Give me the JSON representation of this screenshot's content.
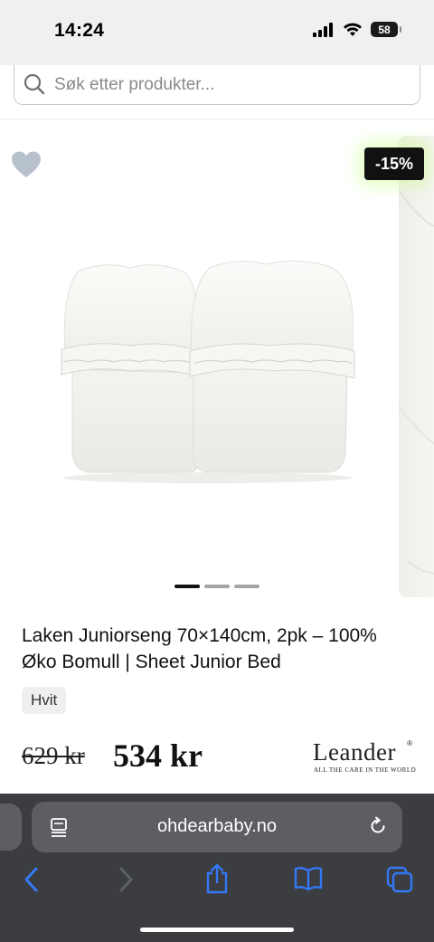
{
  "status_bar": {
    "time": "14:24",
    "battery": "58",
    "icons": [
      "signal-icon",
      "wifi-icon",
      "battery-icon"
    ]
  },
  "search": {
    "placeholder": "Søk etter produkter..."
  },
  "product": {
    "discount_badge": "-15%",
    "image_count": 3,
    "active_image_index": 0,
    "title": "Laken Juniorseng 70×140cm, 2pk – 100% Øko Bomull | Sheet Junior Bed",
    "variant": "Hvit",
    "old_price": "629 kr",
    "new_price": "534 kr"
  },
  "brand": {
    "name": "Leander",
    "tagline": "ALL THE CARE IN THE WORLD"
  },
  "browser": {
    "url": "ohdearbaby.no",
    "buttons": [
      "back-icon",
      "forward-icon",
      "share-icon",
      "bookmarks-icon",
      "tabs-icon"
    ]
  },
  "colors": {
    "browser_bar": "#3b3d41",
    "url_field": "#5c5e63",
    "nav_icons": "#3478f6",
    "badge": "#111111",
    "heart": "#b7c1cc"
  }
}
